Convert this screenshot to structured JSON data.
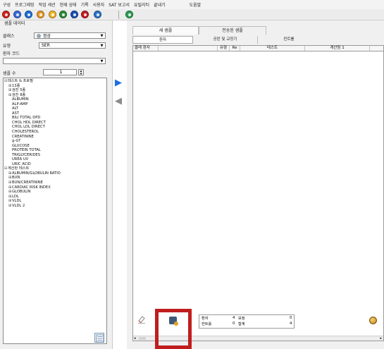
{
  "menubar": {
    "items": [
      "구성",
      "프로그래밍",
      "작업 세션",
      "현재 상태",
      "기록",
      "사용자",
      "SAT 보고서",
      "유틸리티",
      "끝내기"
    ],
    "help": "도움말"
  },
  "toolbar": {
    "buttons": [
      {
        "name": "stop-icon",
        "color": "#d4221c"
      },
      {
        "name": "disc-icon",
        "color": "#3c69d9"
      },
      {
        "name": "sample-icon",
        "color": "#1e6fd6"
      },
      {
        "name": "reagent-icon",
        "color": "#e89a2a"
      },
      {
        "name": "calibration-icon",
        "color": "#f0b42c"
      },
      {
        "name": "qc-icon",
        "color": "#2e8b3d"
      },
      {
        "name": "analysis-icon",
        "color": "#1b4fb8"
      },
      {
        "name": "alarm-icon",
        "color": "#c41d22"
      },
      {
        "name": "maintenance-icon",
        "color": "#2b74c9"
      },
      {
        "name": "monitor-icon",
        "color": "#2f9e55"
      }
    ]
  },
  "left": {
    "group_title": "샘플 데이터",
    "class_label": "클래스",
    "class_value": "정상",
    "type_label": "유형",
    "type_value": "SER",
    "patient_code_label": "환자 코드",
    "patient_code_value": "",
    "sample_count_label": "샘플 수",
    "sample_count_value": "1",
    "tree": [
      {
        "level": 0,
        "exp": "⊟",
        "text": "테스트 & 프로필"
      },
      {
        "level": 1,
        "exp": "⊞",
        "text": "13종"
      },
      {
        "level": 1,
        "exp": "⊞",
        "text": "검진 5종"
      },
      {
        "level": 1,
        "exp": "⊞",
        "text": "검진 8종"
      },
      {
        "level": 1,
        "exp": "",
        "text": "ALBUMIN"
      },
      {
        "level": 1,
        "exp": "",
        "text": "ALP-AMP"
      },
      {
        "level": 1,
        "exp": "",
        "text": "ALT"
      },
      {
        "level": 1,
        "exp": "",
        "text": "AST"
      },
      {
        "level": 1,
        "exp": "",
        "text": "BILI TOTAL DPD"
      },
      {
        "level": 1,
        "exp": "",
        "text": "CHOL HDL DIRECT"
      },
      {
        "level": 1,
        "exp": "",
        "text": "CHOL LDL DIRECT"
      },
      {
        "level": 1,
        "exp": "",
        "text": "CHOLESTEROL"
      },
      {
        "level": 1,
        "exp": "",
        "text": "CREATININE"
      },
      {
        "level": 1,
        "exp": "",
        "text": "g-GT"
      },
      {
        "level": 1,
        "exp": "",
        "text": "GLUCOSE"
      },
      {
        "level": 1,
        "exp": "",
        "text": "PROTEIN TOTAL"
      },
      {
        "level": 1,
        "exp": "",
        "text": "TRIGLYCERIDES"
      },
      {
        "level": 1,
        "exp": "",
        "text": "UREA UV"
      },
      {
        "level": 1,
        "exp": "",
        "text": "URIC ACID"
      },
      {
        "level": 0,
        "exp": "⊟",
        "text": "계산된 테스트"
      },
      {
        "level": 1,
        "exp": "⊞",
        "text": "ALBUMIN/GLOBULIN RATIO"
      },
      {
        "level": 1,
        "exp": "⊞",
        "text": "BUN"
      },
      {
        "level": 1,
        "exp": "⊞",
        "text": "BUN/CREATININE"
      },
      {
        "level": 1,
        "exp": "⊞",
        "text": "CARDIAC RISK INDEX"
      },
      {
        "level": 1,
        "exp": "⊞",
        "text": "GLOBULIN"
      },
      {
        "level": 1,
        "exp": "⊞",
        "text": "LDL"
      },
      {
        "level": 1,
        "exp": "⊞",
        "text": "VLDL"
      },
      {
        "level": 1,
        "exp": "⊞",
        "text": "VLDL 2"
      }
    ]
  },
  "right": {
    "tabs": [
      "새 샘플",
      "전송된 샘플"
    ],
    "subtabs": [
      "환자",
      "공란 및 교정기",
      "컨트롤"
    ],
    "columns": [
      "클래 환자",
      "",
      "유형",
      "Re",
      "테스트",
      "계산됨 1",
      ""
    ]
  },
  "summary": {
    "patient_label": "환자",
    "patient_value": "4",
    "control_label": "컨트롤",
    "control_value": "0",
    "pending_label": "보정",
    "pending_value": "0",
    "total_label": "합계",
    "total_value": "4"
  }
}
